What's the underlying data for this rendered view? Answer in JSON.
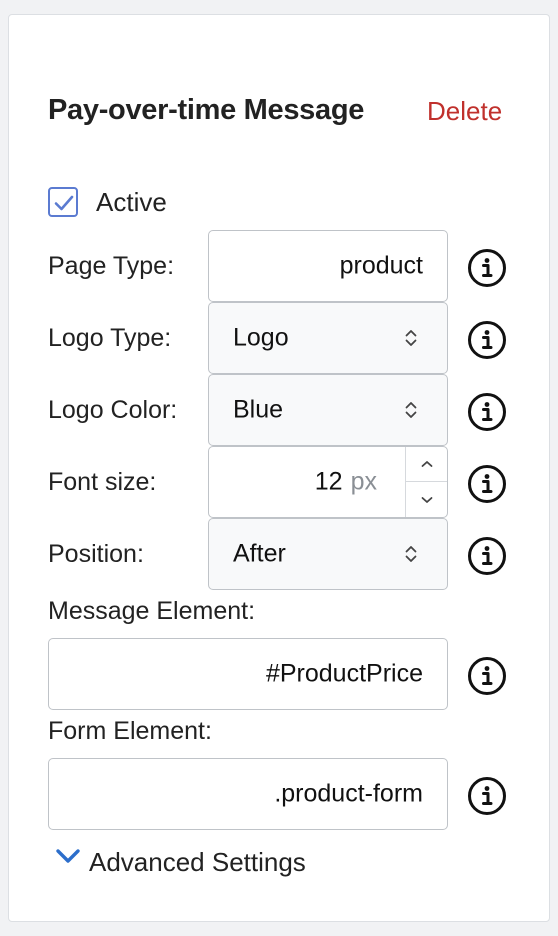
{
  "title": "Pay-over-time Message",
  "delete_label": "Delete",
  "active": {
    "label": "Active",
    "checked": true
  },
  "page_type": {
    "label": "Page Type:",
    "value": "product"
  },
  "logo_type": {
    "label": "Logo Type:",
    "value": "Logo"
  },
  "logo_color": {
    "label": "Logo Color:",
    "value": "Blue"
  },
  "font_size": {
    "label": "Font size:",
    "value": "12",
    "unit": "px"
  },
  "position": {
    "label": "Position:",
    "value": "After"
  },
  "message_element": {
    "label": "Message Element:",
    "value": "#ProductPrice"
  },
  "form_element": {
    "label": "Form Element:",
    "value": ".product-form"
  },
  "advanced": {
    "label": "Advanced Settings"
  },
  "colors": {
    "accent": "#5b7bd1",
    "delete": "#c0302c",
    "chevron": "#2c6ecb"
  },
  "icons": {
    "info": "info-circle-icon",
    "check": "check-icon",
    "select": "select-arrows-icon",
    "chevron": "chevron-down-icon"
  }
}
